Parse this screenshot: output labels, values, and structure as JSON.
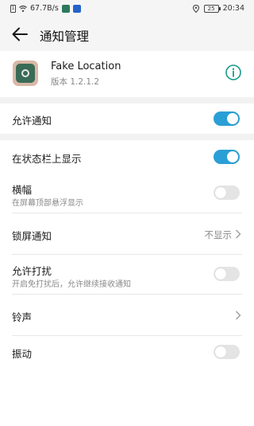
{
  "status_bar": {
    "net_speed": "67.7B/s",
    "battery": "25",
    "time": "20:34",
    "icons": [
      "sim-icon",
      "wifi-icon",
      "app-notification-icon",
      "app-notification-icon",
      "location-icon",
      "battery-icon"
    ]
  },
  "header": {
    "back_icon": "arrow-left-icon",
    "title": "通知管理"
  },
  "app": {
    "name": "Fake Location",
    "version": "版本 1.2.1.2",
    "info_icon": "info-circle-icon"
  },
  "settings": {
    "allow_notifications": {
      "label": "允许通知",
      "enabled": true
    },
    "show_in_status_bar": {
      "label": "在状态栏上显示",
      "enabled": true
    },
    "banner": {
      "label": "横幅",
      "sub": "在屏幕顶部悬浮显示",
      "enabled": false
    },
    "lock_screen": {
      "label": "锁屏通知",
      "value": "不显示"
    },
    "allow_interrupt": {
      "label": "允许打扰",
      "sub": "开启免打扰后，允许继续接收通知",
      "enabled": false
    },
    "ringtone": {
      "label": "铃声"
    },
    "vibration": {
      "label": "振动",
      "enabled": false
    }
  },
  "colors": {
    "accent": "#2a9fd6",
    "teal": "#1a9a8a"
  }
}
